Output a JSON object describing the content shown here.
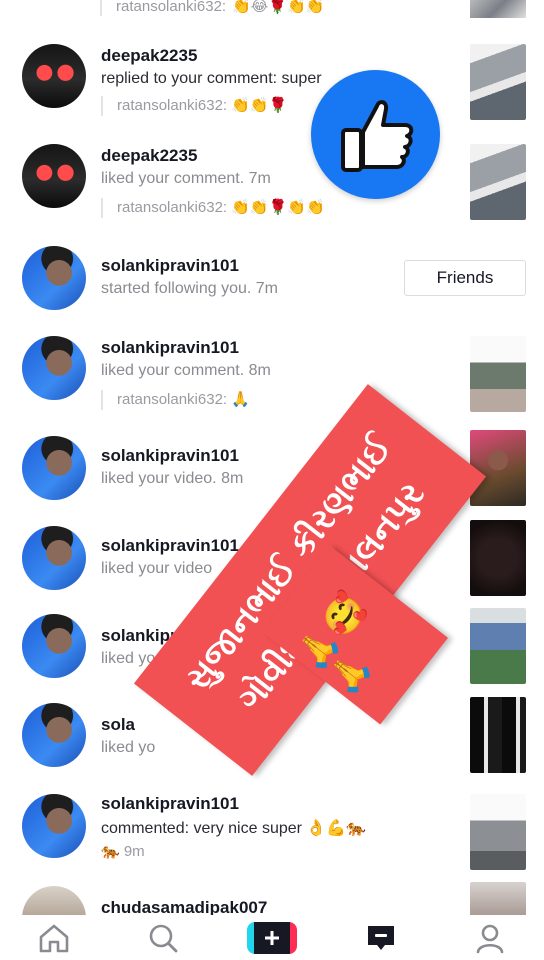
{
  "top_snippet": {
    "text": "ratansolanki632:",
    "emoji": "👏😂🌹👏👏"
  },
  "notifications": [
    {
      "username": "deepak2235",
      "action": "replied to your comment: super",
      "quote_user": "ratansolanki632:",
      "quote_emoji": "👏👏🌹"
    },
    {
      "username": "deepak2235",
      "action": "liked your comment. 7m",
      "quote_user": "ratansolanki632:",
      "quote_emoji": "👏👏🌹👏👏"
    },
    {
      "username": "solankipravin101",
      "action": "started following you. 7m",
      "button_label": "Friends"
    },
    {
      "username": "solankipravin101",
      "action": "liked your comment. 8m",
      "quote_user": "ratansolanki632:",
      "quote_emoji": "🙏"
    },
    {
      "username": "solankipravin101",
      "action": "liked your video. 8m"
    },
    {
      "username": "solankipravin101",
      "action": "liked your video"
    },
    {
      "username": "solankipr",
      "action": "liked yo"
    },
    {
      "username": "sola",
      "action": "liked yo"
    },
    {
      "username": "solankipravin101",
      "action": "commented: very nice super 👌💪🐅",
      "extra": "🐅 9m"
    },
    {
      "username": "chudasamadipak007"
    }
  ],
  "overlay": {
    "banner_line1": "સુજાનભાઈ કીરણભાઈ",
    "banner_line2": "ગોવીદભાઈ પાલનપુર",
    "emoji_line": "🙏🥰🙏"
  },
  "nav": {
    "home_icon": "home-icon",
    "discover_icon": "search-icon",
    "create_icon": "plus-icon",
    "inbox_icon": "inbox-icon",
    "profile_icon": "profile-icon"
  },
  "colors": {
    "like_blue": "#1877f2",
    "banner_red": "#f25153"
  }
}
